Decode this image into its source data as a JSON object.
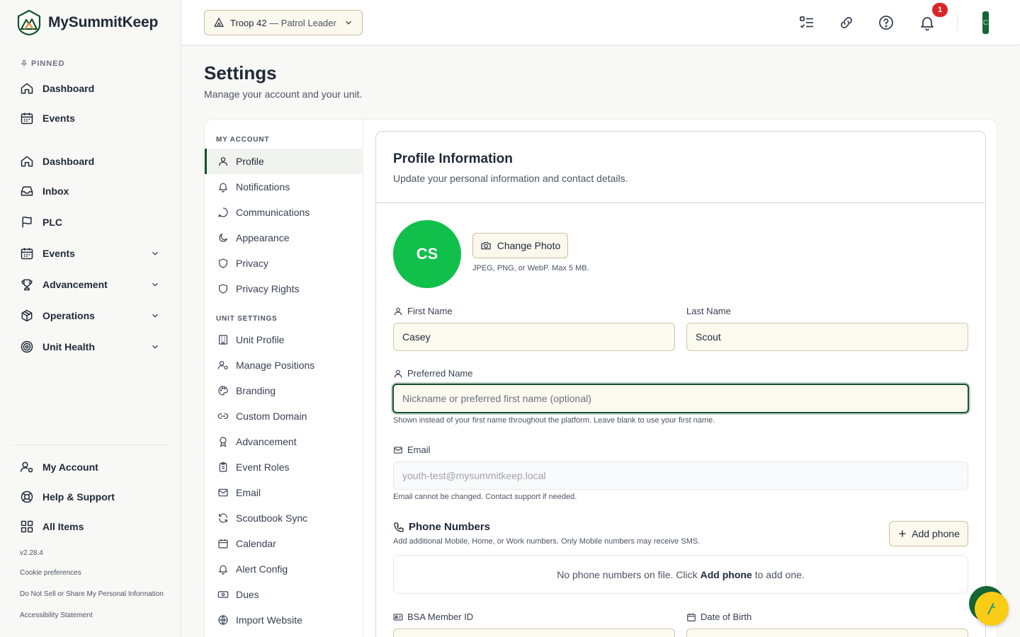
{
  "brand": {
    "name": "MySummitKeep"
  },
  "sidebar": {
    "pinned_label": "PINNED",
    "pinned": [
      {
        "label": "Dashboard",
        "icon": "home-icon"
      },
      {
        "label": "Events",
        "icon": "calendar-icon"
      }
    ],
    "items": [
      {
        "label": "Dashboard",
        "icon": "home-icon"
      },
      {
        "label": "Inbox",
        "icon": "inbox-icon"
      },
      {
        "label": "PLC",
        "icon": "flag-icon"
      },
      {
        "label": "Events",
        "icon": "calendar-icon",
        "expandable": true
      },
      {
        "label": "Advancement",
        "icon": "trophy-icon",
        "expandable": true
      },
      {
        "label": "Operations",
        "icon": "box-icon",
        "expandable": true
      },
      {
        "label": "Unit Health",
        "icon": "target-icon",
        "expandable": true
      }
    ],
    "bottom": [
      {
        "label": "My Account",
        "icon": "user-gear-icon"
      },
      {
        "label": "Help & Support",
        "icon": "lifebuoy-icon"
      },
      {
        "label": "All Items",
        "icon": "grid-icon"
      }
    ],
    "version": "v2.28.4",
    "links": [
      "Cookie preferences",
      "Do Not Sell or Share My Personal Information",
      "Accessibility Statement"
    ]
  },
  "topbar": {
    "unit_name": "Troop 42",
    "unit_role": " — Patrol Leader",
    "notification_count": "1",
    "avatar_initial": "C"
  },
  "page": {
    "title": "Settings",
    "subtitle": "Manage your account and your unit."
  },
  "subnav": {
    "account_heading": "MY ACCOUNT",
    "account_items": [
      "Profile",
      "Notifications",
      "Communications",
      "Appearance",
      "Privacy",
      "Privacy Rights"
    ],
    "unit_heading": "UNIT SETTINGS",
    "unit_items": [
      "Unit Profile",
      "Manage Positions",
      "Branding",
      "Custom Domain",
      "Advancement",
      "Event Roles",
      "Email",
      "Scoutbook Sync",
      "Calendar",
      "Alert Config",
      "Dues",
      "Import Website"
    ],
    "active": "Profile"
  },
  "profile": {
    "title": "Profile Information",
    "subtitle": "Update your personal information and contact details.",
    "initials": "CS",
    "avatar_color": "#10c04a",
    "change_photo": "Change Photo",
    "photo_hint": "JPEG, PNG, or WebP. Max 5 MB.",
    "first_name_label": "First Name",
    "first_name": "Casey",
    "last_name_label": "Last Name",
    "last_name": "Scout",
    "preferred_label": "Preferred Name",
    "preferred_value": "",
    "preferred_placeholder": "Nickname or preferred first name (optional)",
    "preferred_help": "Shown instead of your first name throughout the platform. Leave blank to use your first name.",
    "email_label": "Email",
    "email": "youth-test@mysummitkeep.local",
    "email_help": "Email cannot be changed. Contact support if needed.",
    "phones_title": "Phone Numbers",
    "phones_sub": "Add additional Mobile, Home, or Work numbers. Only Mobile numbers may receive SMS.",
    "add_phone": "Add phone",
    "phones_empty_pre": "No phone numbers on file. Click",
    "phones_empty_bold": "Add phone",
    "phones_empty_post": "to add one.",
    "member_id_label": "BSA Member ID",
    "dob_label": "Date of Birth"
  },
  "colors": {
    "accent": "#14532d",
    "badge": "#dc2626",
    "fab": "#facc15"
  }
}
